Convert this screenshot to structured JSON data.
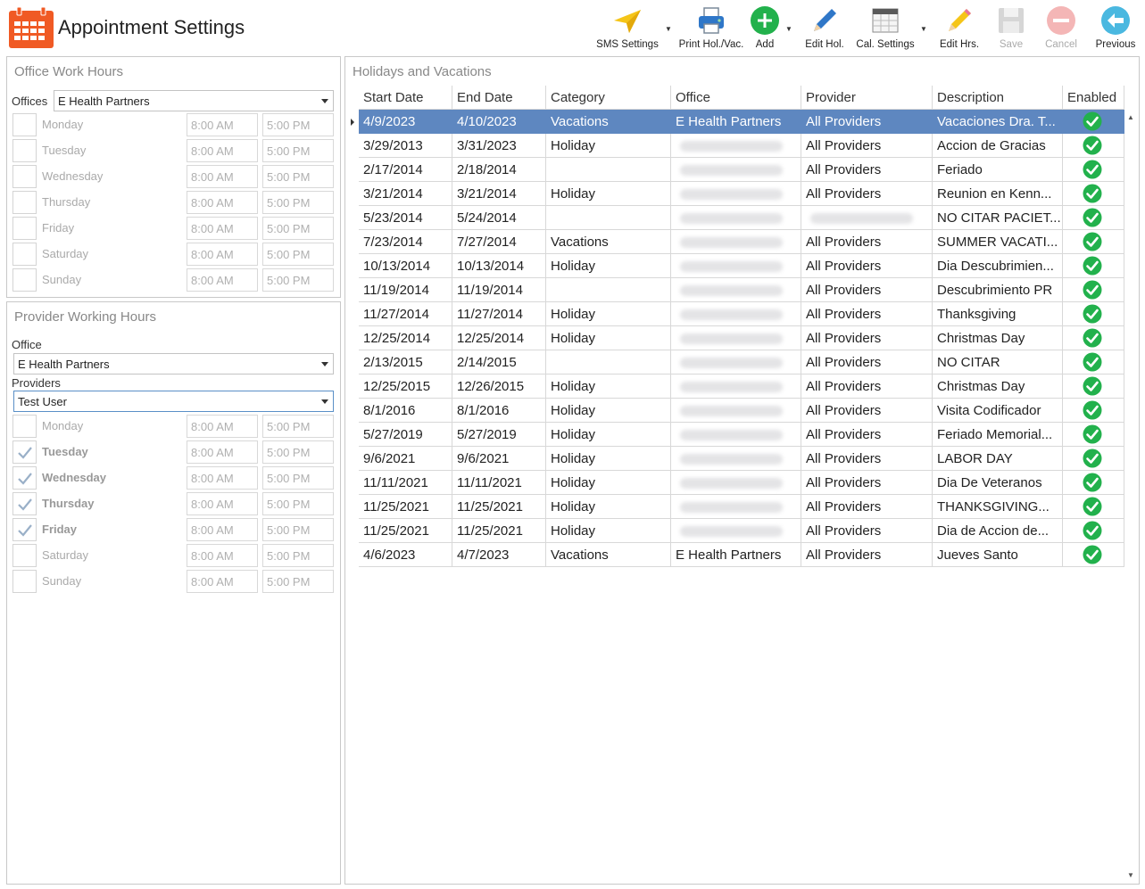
{
  "app": {
    "title": "Appointment Settings",
    "icon": "calendar-icon"
  },
  "toolbar": {
    "sms_settings": "SMS Settings",
    "print": "Print Hol./Vac.",
    "add": "Add",
    "edit_hol": "Edit Hol.",
    "cal_settings": "Cal. Settings",
    "edit_hrs": "Edit Hrs.",
    "save": "Save",
    "cancel": "Cancel",
    "previous": "Previous"
  },
  "office_hours": {
    "title": "Office Work Hours",
    "offices_label": "Offices",
    "office_value": "E Health Partners",
    "days": [
      {
        "name": "Monday",
        "start": "8:00 AM",
        "end": "5:00 PM",
        "checked": false
      },
      {
        "name": "Tuesday",
        "start": "8:00 AM",
        "end": "5:00 PM",
        "checked": false
      },
      {
        "name": "Wednesday",
        "start": "8:00 AM",
        "end": "5:00 PM",
        "checked": false
      },
      {
        "name": "Thursday",
        "start": "8:00 AM",
        "end": "5:00 PM",
        "checked": false
      },
      {
        "name": "Friday",
        "start": "8:00 AM",
        "end": "5:00 PM",
        "checked": false
      },
      {
        "name": "Saturday",
        "start": "8:00 AM",
        "end": "5:00 PM",
        "checked": false
      },
      {
        "name": "Sunday",
        "start": "8:00 AM",
        "end": "5:00 PM",
        "checked": false
      }
    ]
  },
  "provider_hours": {
    "title": "Provider Working Hours",
    "office_label": "Office",
    "office_value": "E Health Partners",
    "providers_label": "Providers",
    "provider_value": "Test User",
    "days": [
      {
        "name": "Monday",
        "start": "8:00 AM",
        "end": "5:00 PM",
        "checked": false
      },
      {
        "name": "Tuesday",
        "start": "8:00 AM",
        "end": "5:00 PM",
        "checked": true
      },
      {
        "name": "Wednesday",
        "start": "8:00 AM",
        "end": "5:00 PM",
        "checked": true
      },
      {
        "name": "Thursday",
        "start": "8:00 AM",
        "end": "5:00 PM",
        "checked": true
      },
      {
        "name": "Friday",
        "start": "8:00 AM",
        "end": "5:00 PM",
        "checked": true
      },
      {
        "name": "Saturday",
        "start": "8:00 AM",
        "end": "5:00 PM",
        "checked": false
      },
      {
        "name": "Sunday",
        "start": "8:00 AM",
        "end": "5:00 PM",
        "checked": false
      }
    ]
  },
  "holidays": {
    "title": "Holidays and Vacations",
    "columns": [
      "Start Date",
      "End Date",
      "Category",
      "Office",
      "Provider",
      "Description",
      "Enabled"
    ],
    "rows": [
      {
        "start": "4/9/2023",
        "end": "4/10/2023",
        "category": "Vacations",
        "office": "E Health Partners",
        "provider": "All Providers",
        "description": "Vacaciones Dra. T...",
        "enabled": true,
        "office_blurred": false,
        "provider_blurred": false,
        "selected": true
      },
      {
        "start": "3/29/2013",
        "end": "3/31/2023",
        "category": "Holiday",
        "office": "",
        "provider": "All Providers",
        "description": "Accion de Gracias",
        "enabled": true,
        "office_blurred": true,
        "provider_blurred": false,
        "selected": false
      },
      {
        "start": "2/17/2014",
        "end": "2/18/2014",
        "category": "",
        "office": "",
        "provider": "All Providers",
        "description": "Feriado",
        "enabled": true,
        "office_blurred": true,
        "provider_blurred": false,
        "selected": false
      },
      {
        "start": "3/21/2014",
        "end": "3/21/2014",
        "category": "Holiday",
        "office": "",
        "provider": "All Providers",
        "description": "Reunion en Kenn...",
        "enabled": true,
        "office_blurred": true,
        "provider_blurred": false,
        "selected": false
      },
      {
        "start": "5/23/2014",
        "end": "5/24/2014",
        "category": "",
        "office": "",
        "provider": "",
        "description": "NO CITAR PACIET...",
        "enabled": true,
        "office_blurred": true,
        "provider_blurred": true,
        "selected": false
      },
      {
        "start": "7/23/2014",
        "end": "7/27/2014",
        "category": "Vacations",
        "office": "",
        "provider": "All Providers",
        "description": "SUMMER VACATI...",
        "enabled": true,
        "office_blurred": true,
        "provider_blurred": false,
        "selected": false
      },
      {
        "start": "10/13/2014",
        "end": "10/13/2014",
        "category": "Holiday",
        "office": "",
        "provider": "All Providers",
        "description": "Dia Descubrimien...",
        "enabled": true,
        "office_blurred": true,
        "provider_blurred": false,
        "selected": false
      },
      {
        "start": "11/19/2014",
        "end": "11/19/2014",
        "category": "",
        "office": "",
        "provider": "All Providers",
        "description": "Descubrimiento PR",
        "enabled": true,
        "office_blurred": true,
        "provider_blurred": false,
        "selected": false
      },
      {
        "start": "11/27/2014",
        "end": "11/27/2014",
        "category": "Holiday",
        "office": "",
        "provider": "All Providers",
        "description": "Thanksgiving",
        "enabled": true,
        "office_blurred": true,
        "provider_blurred": false,
        "selected": false
      },
      {
        "start": "12/25/2014",
        "end": "12/25/2014",
        "category": "Holiday",
        "office": "",
        "provider": "All Providers",
        "description": "Christmas Day",
        "enabled": true,
        "office_blurred": true,
        "provider_blurred": false,
        "selected": false
      },
      {
        "start": "2/13/2015",
        "end": "2/14/2015",
        "category": "",
        "office": "",
        "provider": "All Providers",
        "description": "NO CITAR",
        "enabled": true,
        "office_blurred": true,
        "provider_blurred": false,
        "selected": false
      },
      {
        "start": "12/25/2015",
        "end": "12/26/2015",
        "category": "Holiday",
        "office": "",
        "provider": "All Providers",
        "description": "Christmas Day",
        "enabled": true,
        "office_blurred": true,
        "provider_blurred": false,
        "selected": false
      },
      {
        "start": "8/1/2016",
        "end": "8/1/2016",
        "category": "Holiday",
        "office": "",
        "provider": "All Providers",
        "description": "Visita Codificador",
        "enabled": true,
        "office_blurred": true,
        "provider_blurred": false,
        "selected": false
      },
      {
        "start": "5/27/2019",
        "end": "5/27/2019",
        "category": "Holiday",
        "office": "",
        "provider": "All Providers",
        "description": "Feriado Memorial...",
        "enabled": true,
        "office_blurred": true,
        "provider_blurred": false,
        "selected": false
      },
      {
        "start": "9/6/2021",
        "end": "9/6/2021",
        "category": "Holiday",
        "office": "",
        "provider": "All Providers",
        "description": "LABOR DAY",
        "enabled": true,
        "office_blurred": true,
        "provider_blurred": false,
        "selected": false
      },
      {
        "start": "11/11/2021",
        "end": "11/11/2021",
        "category": "Holiday",
        "office": "",
        "provider": "All Providers",
        "description": "Dia De Veteranos",
        "enabled": true,
        "office_blurred": true,
        "provider_blurred": false,
        "selected": false
      },
      {
        "start": "11/25/2021",
        "end": "11/25/2021",
        "category": "Holiday",
        "office": "",
        "provider": "All Providers",
        "description": "THANKSGIVING...",
        "enabled": true,
        "office_blurred": true,
        "provider_blurred": false,
        "selected": false
      },
      {
        "start": "11/25/2021",
        "end": "11/25/2021",
        "category": "Holiday",
        "office": "",
        "provider": "All Providers",
        "description": "Dia de Accion de...",
        "enabled": true,
        "office_blurred": true,
        "provider_blurred": false,
        "selected": false
      },
      {
        "start": "4/6/2023",
        "end": "4/7/2023",
        "category": "Vacations",
        "office": "E Health Partners",
        "provider": "All Providers",
        "description": "Jueves Santo",
        "enabled": true,
        "office_blurred": false,
        "provider_blurred": false,
        "selected": false
      }
    ]
  },
  "colors": {
    "selection": "#5e87c0",
    "accent_orange": "#f05a24",
    "check_green": "#22b14c"
  }
}
